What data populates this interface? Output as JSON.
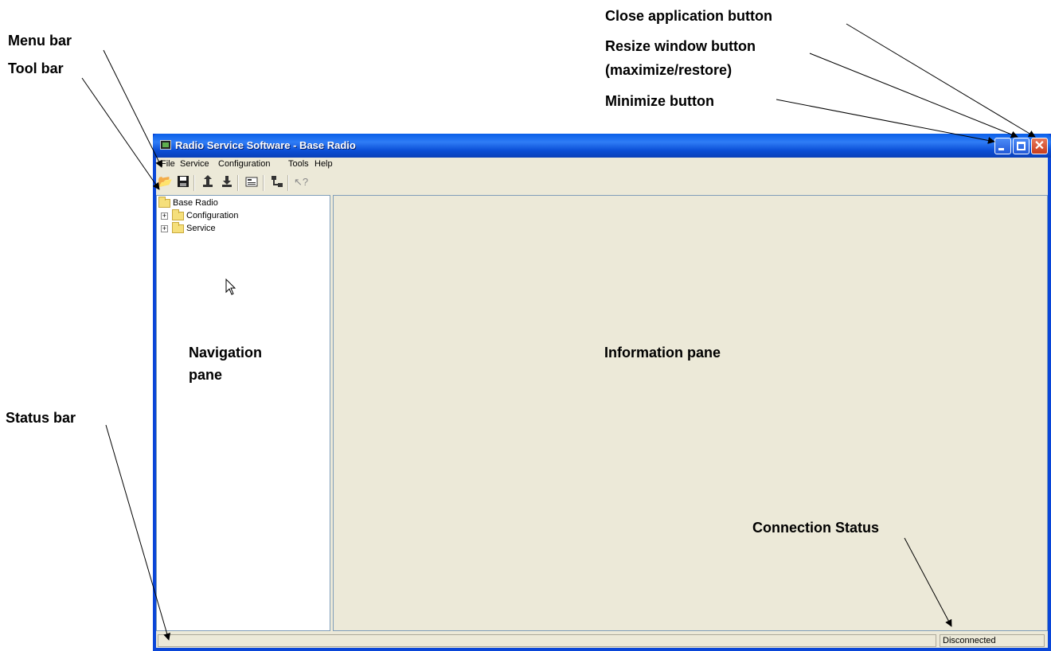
{
  "annotations": {
    "menu_bar": "Menu bar",
    "tool_bar": "Tool bar",
    "status_bar": "Status bar",
    "close_button": "Close application button",
    "resize_button_1": "Resize window button",
    "resize_button_2": "(maximize/restore)",
    "minimize_button": "Minimize button",
    "navigation_pane_1": "Navigation",
    "navigation_pane_2": "pane",
    "information_pane": "Information pane",
    "connection_status": "Connection Status"
  },
  "window": {
    "title": "Radio Service Software - Base Radio"
  },
  "menu": {
    "file": "File",
    "service": "Service",
    "configuration": "Configuration",
    "tools": "Tools",
    "help": "Help"
  },
  "toolbar": {
    "icons": [
      "open-icon",
      "save-icon",
      "upload-icon",
      "download-icon",
      "properties-icon",
      "network-icon",
      "help-pointer-icon"
    ]
  },
  "tree": {
    "root": "Base Radio",
    "children": [
      "Configuration",
      "Service"
    ]
  },
  "statusbar": {
    "left": "",
    "connection": "Disconnected"
  }
}
